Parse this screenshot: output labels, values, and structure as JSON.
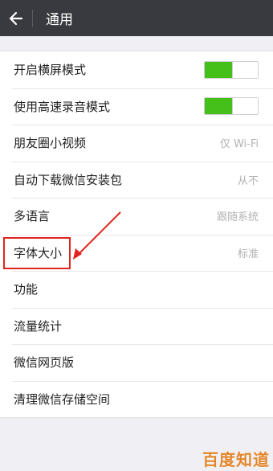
{
  "header": {
    "title": "通用"
  },
  "settings": {
    "items": [
      {
        "label": "开启横屏模式",
        "value": ""
      },
      {
        "label": "使用高速录音模式",
        "value": ""
      },
      {
        "label": "朋友圈小视频",
        "value": "仅 Wi-Fi"
      },
      {
        "label": "自动下载微信安装包",
        "value": "从不"
      },
      {
        "label": "多语言",
        "value": "跟随系统"
      },
      {
        "label": "字体大小",
        "value": "标准"
      },
      {
        "label": "功能",
        "value": ""
      },
      {
        "label": "流量统计",
        "value": ""
      },
      {
        "label": "微信网页版",
        "value": ""
      },
      {
        "label": "清理微信存储空间",
        "value": ""
      }
    ],
    "landscape_mode_on": true,
    "hd_recording_on": true
  },
  "watermark": {
    "text": "百度知道"
  },
  "colors": {
    "titlebar": "#393a3f",
    "toggle_on": "#45c01a",
    "annotation": "#e0241e",
    "background": "#f0eff4"
  }
}
